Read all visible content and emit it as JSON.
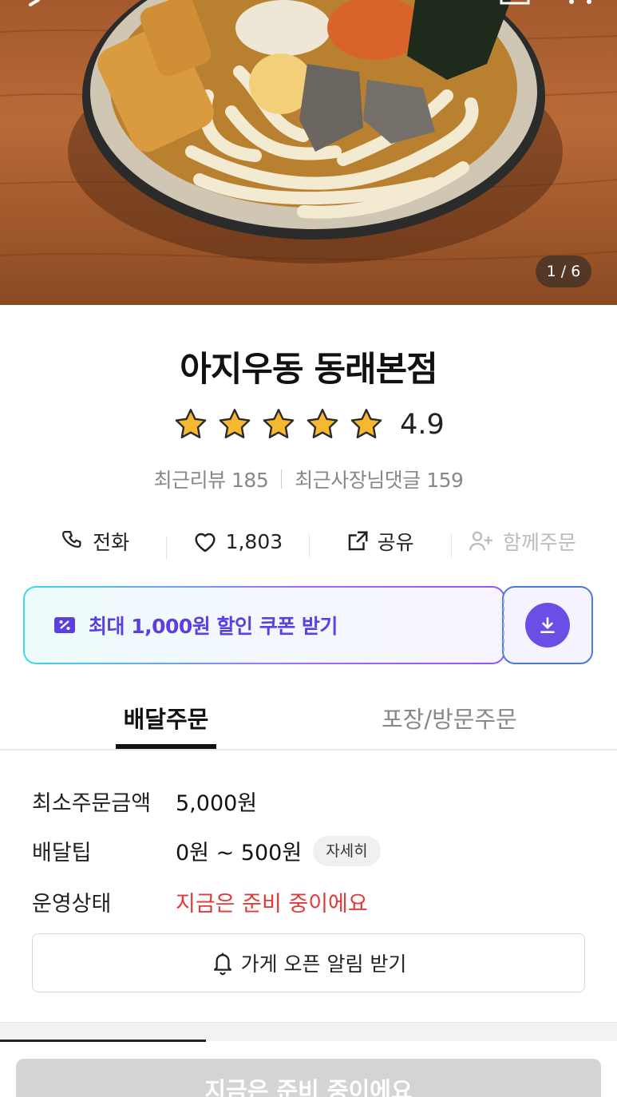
{
  "hero": {
    "image_counter": "1 / 6",
    "back_icon": "chevron-left-icon",
    "more_icon": "more-dots-icon"
  },
  "store": {
    "name": "아지우동 동래본점",
    "rating": "4.9",
    "stars_filled": 5,
    "stars_total": 5,
    "recent_reviews_label": "최근리뷰 185",
    "owner_replies_label": "최근사장님댓글 159"
  },
  "actions": {
    "call_label": "전화",
    "like_count": "1,803",
    "share_label": "공유",
    "group_order_label": "함께주문"
  },
  "coupon": {
    "label": "최대 1,000원 할인 쿠폰 받기"
  },
  "tabs": [
    {
      "label": "배달주문",
      "active": true
    },
    {
      "label": "포장/방문주문",
      "active": false
    }
  ],
  "info": {
    "min_order_label": "최소주문금액",
    "min_order_value": "5,000원",
    "delivery_tip_label": "배달팁",
    "delivery_tip_value": "0원 ~ 500원",
    "details_chip": "자세히",
    "status_label": "운영상태",
    "status_value": "지금은 준비 중이에요"
  },
  "notify_button": "가게 오픈 알림 받기",
  "bottom_cta": "지금은 준비 중이에요",
  "colors": {
    "accent_purple": "#6b4ee6",
    "status_red": "#e23a3a",
    "star_yellow": "#f5b82e"
  }
}
